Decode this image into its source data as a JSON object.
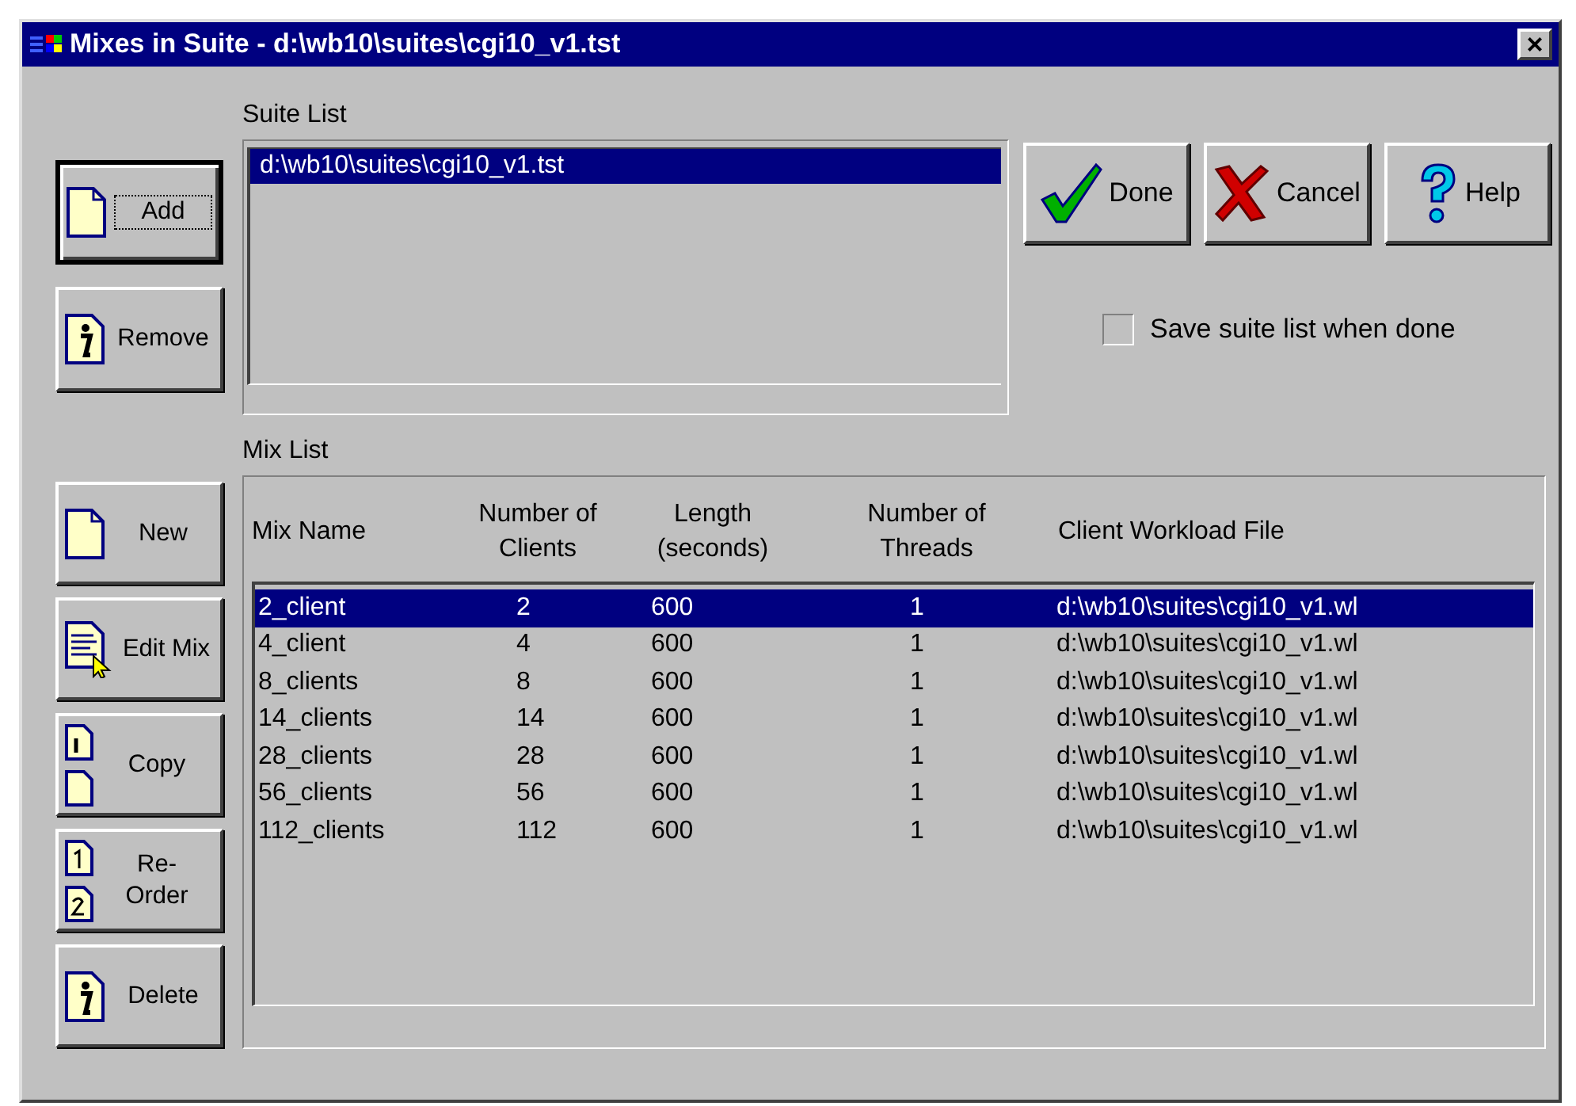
{
  "window": {
    "title": "Mixes in Suite - d:\\wb10\\suites\\cgi10_v1.tst",
    "close": "×"
  },
  "suite_buttons": [
    {
      "label": "Add",
      "kind": "page",
      "focused": true
    },
    {
      "label": "Remove",
      "kind": "info",
      "focused": false
    }
  ],
  "suite_list": {
    "label": "Suite List",
    "items": [
      {
        "text": "d:\\wb10\\suites\\cgi10_v1.tst",
        "selected": true
      }
    ]
  },
  "dialog_buttons": [
    {
      "label": "Done",
      "kind": "check"
    },
    {
      "label": "Cancel",
      "kind": "cross"
    },
    {
      "label": "Help",
      "kind": "question"
    }
  ],
  "save_checkbox": {
    "label": "Save suite list when done",
    "checked": false
  },
  "mix_buttons": [
    {
      "label": "New",
      "kind": "page"
    },
    {
      "label": "Edit Mix",
      "kind": "edit"
    },
    {
      "label": "Copy",
      "kind": "copy"
    },
    {
      "label": "Re- Order",
      "kind": "reorder"
    },
    {
      "label": "Delete",
      "kind": "info"
    }
  ],
  "mix_list": {
    "label": "Mix List",
    "columns": [
      "Mix Name",
      "Number of Clients",
      "Length (seconds)",
      "Number of Threads",
      "Client Workload File"
    ],
    "rows": [
      {
        "cells": [
          "2_client",
          "2",
          "600",
          "1",
          "d:\\wb10\\suites\\cgi10_v1.wl"
        ],
        "selected": true
      },
      {
        "cells": [
          "4_client",
          "4",
          "600",
          "1",
          "d:\\wb10\\suites\\cgi10_v1.wl"
        ],
        "selected": false
      },
      {
        "cells": [
          "8_clients",
          "8",
          "600",
          "1",
          "d:\\wb10\\suites\\cgi10_v1.wl"
        ],
        "selected": false
      },
      {
        "cells": [
          "14_clients",
          "14",
          "600",
          "1",
          "d:\\wb10\\suites\\cgi10_v1.wl"
        ],
        "selected": false
      },
      {
        "cells": [
          "28_clients",
          "28",
          "600",
          "1",
          "d:\\wb10\\suites\\cgi10_v1.wl"
        ],
        "selected": false
      },
      {
        "cells": [
          "56_clients",
          "56",
          "600",
          "1",
          "d:\\wb10\\suites\\cgi10_v1.wl"
        ],
        "selected": false
      },
      {
        "cells": [
          "112_clients",
          "112",
          "600",
          "1",
          "d:\\wb10\\suites\\cgi10_v1.wl"
        ],
        "selected": false
      }
    ]
  }
}
